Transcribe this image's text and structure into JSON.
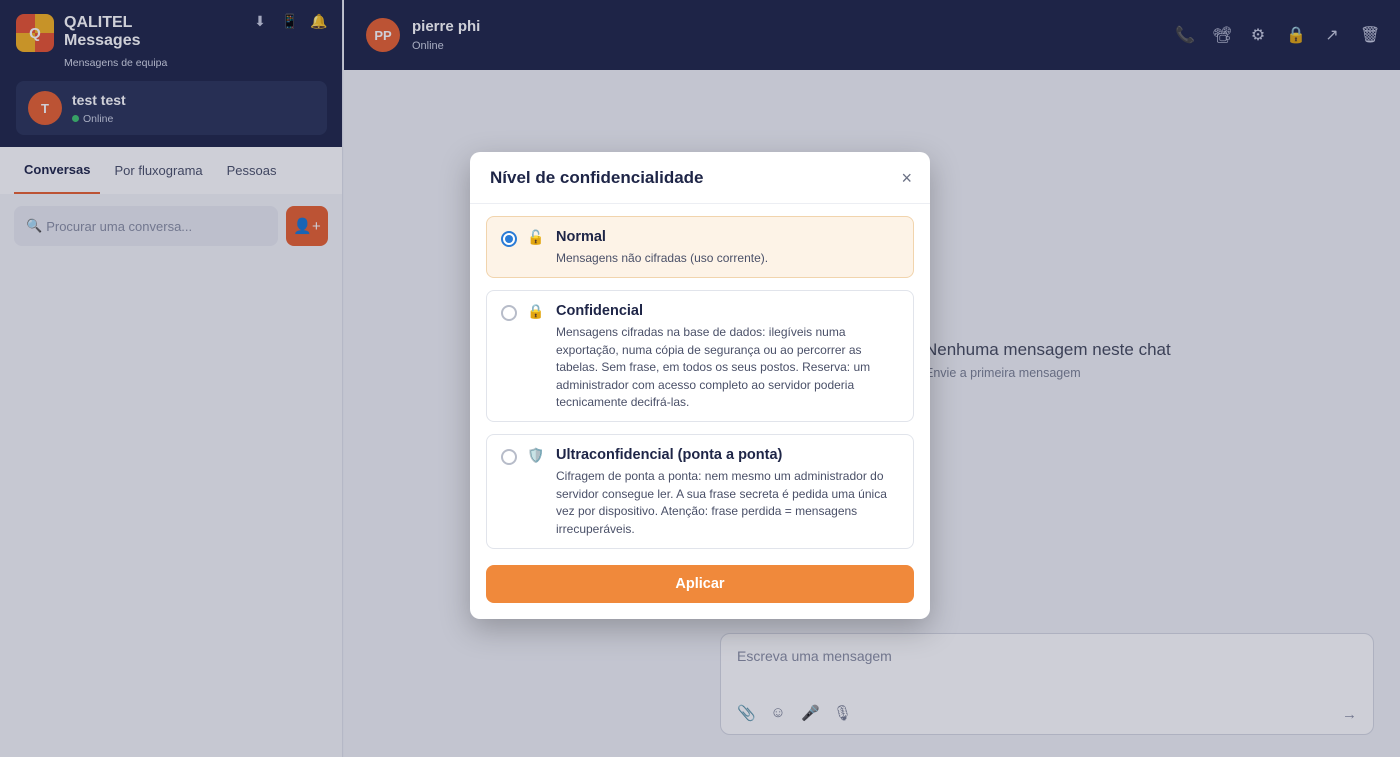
{
  "app": {
    "logo_letter": "Q",
    "title": "QALITEL Messages",
    "subtitle": "Mensagens de equipa",
    "header_icons": [
      "download-icon",
      "phone-device-icon",
      "bell-icon"
    ]
  },
  "current_user": {
    "initial": "T",
    "name": "test test",
    "status": "Online"
  },
  "tabs": [
    {
      "label": "Conversas",
      "active": true
    },
    {
      "label": "Por fluxograma",
      "active": false
    },
    {
      "label": "Pessoas",
      "active": false
    }
  ],
  "search": {
    "placeholder": "Procurar uma conversa...",
    "value": ""
  },
  "chat": {
    "initials": "PP",
    "name": "pierre phi",
    "status": "Online",
    "actions": [
      "phone-icon",
      "video-camera-icon",
      "gear-icon",
      "lock-icon",
      "share-arrow-icon",
      "trash-icon"
    ],
    "empty_title": "Nenhuma mensagem neste chat",
    "empty_subtitle": "Envie a primeira mensagem"
  },
  "composer": {
    "placeholder": "Escreva uma mensagem",
    "value": "",
    "icons": [
      "paperclip-icon",
      "emoji-icon",
      "microphone-icon",
      "voice-record-icon"
    ],
    "send_glyph": "→"
  },
  "modal": {
    "title": "Nível de confidencialidade",
    "close_glyph": "×",
    "options": [
      {
        "icon": "🔓",
        "title": "Normal",
        "description": "Mensagens não cifradas (uso corrente).",
        "selected": true
      },
      {
        "icon": "🔒",
        "title": "Confidencial",
        "description": "Mensagens cifradas na base de dados: ilegíveis numa exportação, numa cópia de segurança ou ao percorrer as tabelas. Sem frase, em todos os seus postos. Reserva: um administrador com acesso completo ao servidor poderia tecnicamente decifrá-las.",
        "selected": false
      },
      {
        "icon": "🛡️",
        "title": "Ultraconfidencial (ponta a ponta)",
        "description": "Cifragem de ponta a ponta: nem mesmo um administrador do servidor consegue ler. A sua frase secreta é pedida uma única vez por dispositivo. Atenção: frase perdida = mensagens irrecuperáveis.",
        "selected": false
      }
    ],
    "apply_label": "Aplicar"
  },
  "colors": {
    "navy": "#1e2547",
    "accent_orange": "#e8602f",
    "apply_orange": "#f0893b",
    "online_green": "#3ec46d",
    "radio_blue": "#2a7bd6"
  }
}
